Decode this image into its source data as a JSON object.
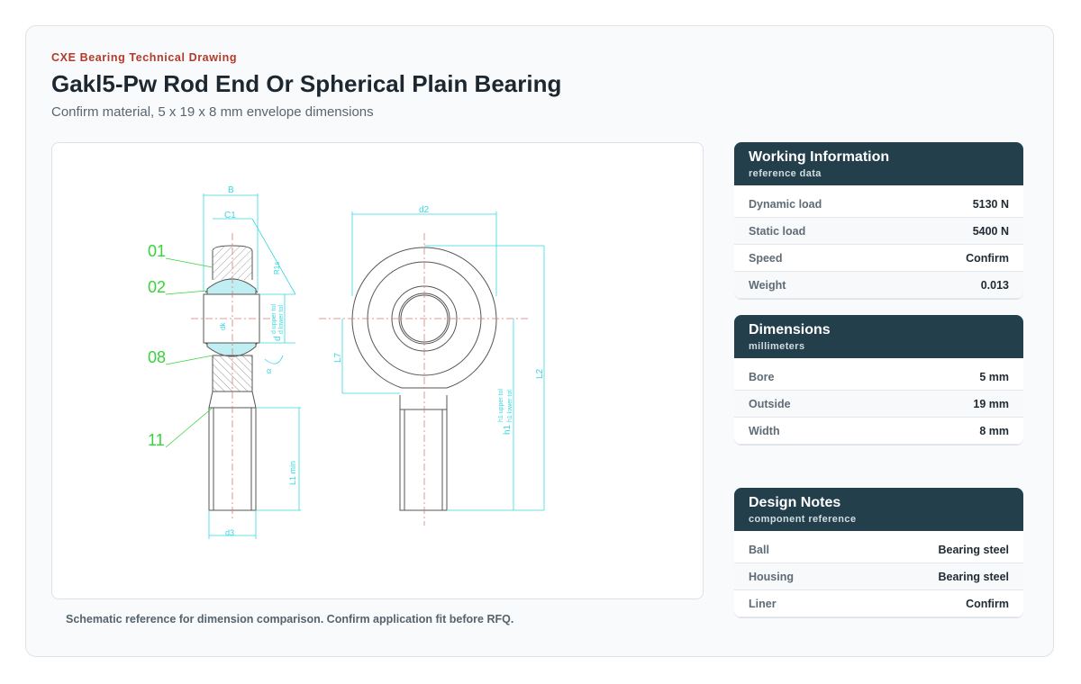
{
  "header": {
    "eyebrow": "CXE Bearing Technical Drawing",
    "title": "Gakl5-Pw Rod End Or Spherical Plain Bearing",
    "subtitle": "Confirm material, 5 x 19 x 8 mm envelope dimensions"
  },
  "drawing": {
    "caption": "Schematic reference for dimension comparison. Confirm application fit before RFQ.",
    "callouts": [
      "01",
      "02",
      "08",
      "11"
    ],
    "side_labels": {
      "b": "B",
      "c1": "C1",
      "r1s": "R1s",
      "d_upper": "d upper tol",
      "d_lower": "d lower tol",
      "d": "d",
      "dk": "dk",
      "alpha": "α",
      "l1": "L1 min",
      "d3": "d3"
    },
    "front_labels": {
      "d2": "d2",
      "l7": "L7",
      "l2": "L2",
      "h1": "h1",
      "h1_upper": "h1 upper tol",
      "h1_lower": "h1 lower tol"
    },
    "colors": {
      "outline": "#555555",
      "dimension": "#35d8e3",
      "callout": "#35d43b",
      "center": "#d77a7a"
    }
  },
  "panels": [
    {
      "title": "Working Information",
      "subtitle": "reference data",
      "rows": [
        {
          "label": "Dynamic load",
          "value": "5130 N"
        },
        {
          "label": "Static load",
          "value": "5400 N"
        },
        {
          "label": "Speed",
          "value": "Confirm"
        },
        {
          "label": "Weight",
          "value": "0.013"
        }
      ]
    },
    {
      "title": "Dimensions",
      "subtitle": "millimeters",
      "rows": [
        {
          "label": "Bore",
          "value": "5 mm"
        },
        {
          "label": "Outside",
          "value": "19 mm"
        },
        {
          "label": "Width",
          "value": "8 mm"
        }
      ]
    },
    {
      "title": "Design Notes",
      "subtitle": "component reference",
      "rows": [
        {
          "label": "Ball",
          "value": "Bearing steel"
        },
        {
          "label": "Housing",
          "value": "Bearing steel"
        },
        {
          "label": "Liner",
          "value": "Confirm"
        }
      ]
    }
  ]
}
